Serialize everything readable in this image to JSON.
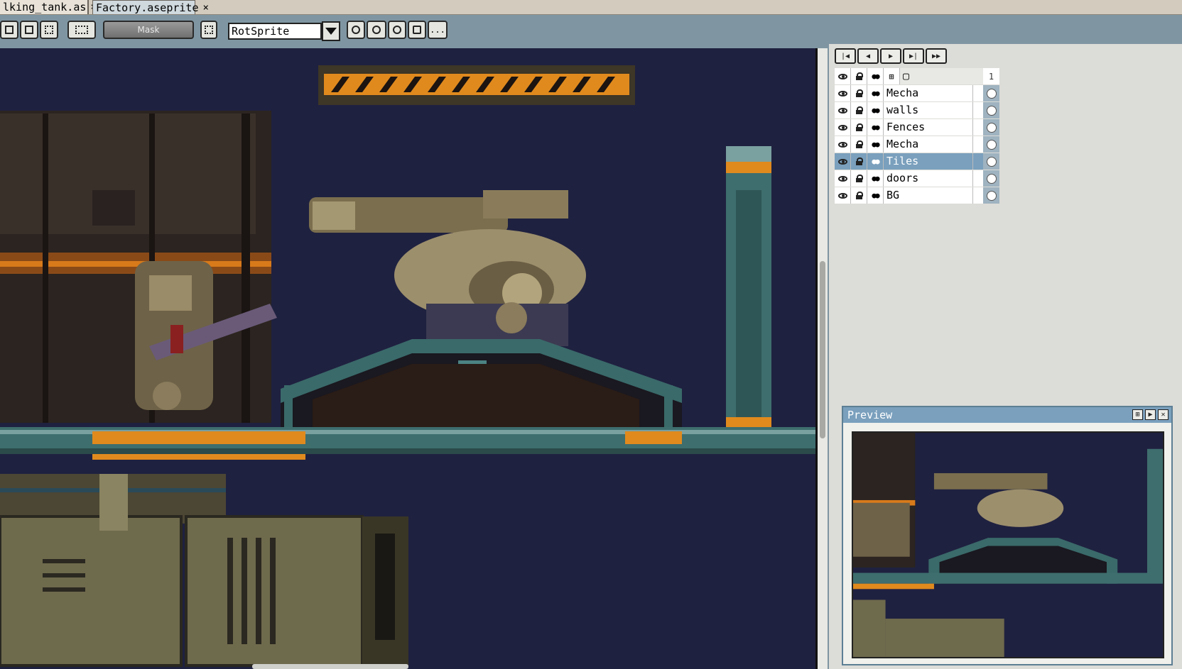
{
  "tabs": [
    {
      "label": "lking_tank.as",
      "close": "×"
    },
    {
      "label": "Factory.aseprite",
      "close": "×"
    }
  ],
  "toolbar": {
    "mask_label": "Mask",
    "rotation_algorithm": "RotSprite",
    "more_label": "..."
  },
  "layers_panel": {
    "frame_number": "1",
    "layers": [
      {
        "name": "Mecha",
        "selected": false
      },
      {
        "name": "walls",
        "selected": false
      },
      {
        "name": "Fences",
        "selected": false
      },
      {
        "name": "Mecha",
        "selected": false
      },
      {
        "name": "Tiles",
        "selected": true
      },
      {
        "name": "doors",
        "selected": false
      },
      {
        "name": "BG",
        "selected": false
      }
    ]
  },
  "preview": {
    "title": "Preview"
  },
  "colors": {
    "canvas_bg": "#1f2140",
    "panel_bg": "#dcdcd8",
    "selection": "#7aa0bd",
    "accent_orange": "#e08a1e"
  }
}
